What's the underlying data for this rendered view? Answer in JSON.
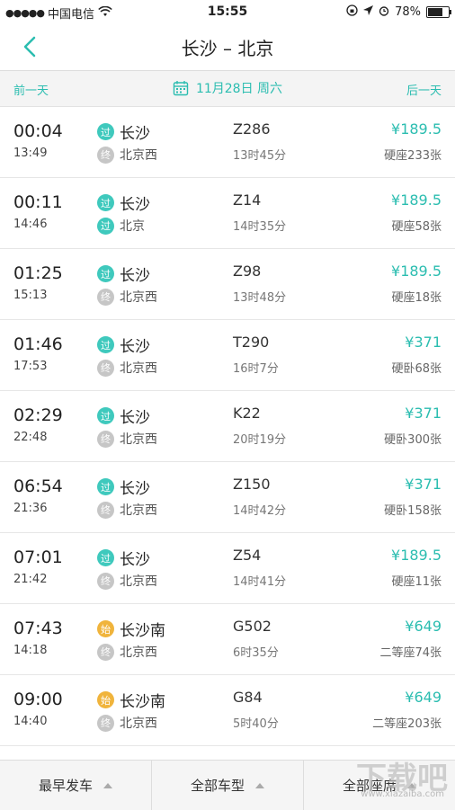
{
  "status": {
    "signal_dots": "●●●●●",
    "carrier": "中国电信",
    "time": "15:55",
    "battery": "78%",
    "battery_level": 0.78
  },
  "nav": {
    "title": "长沙 – 北京"
  },
  "datebar": {
    "prev": "前一天",
    "date": "11月28日 周六",
    "next": "后一天"
  },
  "colors": {
    "accent": "#2bbdb0",
    "pass_badge": "#3fc9bd",
    "end_badge": "#c6c6c6",
    "start_badge": "#f0b43c"
  },
  "trains": [
    {
      "dep": "00:04",
      "arr": "13:49",
      "from_badge": "过",
      "from_type": "pass",
      "from": "长沙",
      "to_badge": "终",
      "to_type": "end",
      "to": "北京西",
      "train": "Z286",
      "duration": "13时45分",
      "price": "¥189.5",
      "seat": "硬座233张"
    },
    {
      "dep": "00:11",
      "arr": "14:46",
      "from_badge": "过",
      "from_type": "pass",
      "from": "长沙",
      "to_badge": "过",
      "to_type": "pass",
      "to": "北京",
      "train": "Z14",
      "duration": "14时35分",
      "price": "¥189.5",
      "seat": "硬座58张"
    },
    {
      "dep": "01:25",
      "arr": "15:13",
      "from_badge": "过",
      "from_type": "pass",
      "from": "长沙",
      "to_badge": "终",
      "to_type": "end",
      "to": "北京西",
      "train": "Z98",
      "duration": "13时48分",
      "price": "¥189.5",
      "seat": "硬座18张"
    },
    {
      "dep": "01:46",
      "arr": "17:53",
      "from_badge": "过",
      "from_type": "pass",
      "from": "长沙",
      "to_badge": "终",
      "to_type": "end",
      "to": "北京西",
      "train": "T290",
      "duration": "16时7分",
      "price": "¥371",
      "seat": "硬卧68张"
    },
    {
      "dep": "02:29",
      "arr": "22:48",
      "from_badge": "过",
      "from_type": "pass",
      "from": "长沙",
      "to_badge": "终",
      "to_type": "end",
      "to": "北京西",
      "train": "K22",
      "duration": "20时19分",
      "price": "¥371",
      "seat": "硬卧300张"
    },
    {
      "dep": "06:54",
      "arr": "21:36",
      "from_badge": "过",
      "from_type": "pass",
      "from": "长沙",
      "to_badge": "终",
      "to_type": "end",
      "to": "北京西",
      "train": "Z150",
      "duration": "14时42分",
      "price": "¥371",
      "seat": "硬卧158张"
    },
    {
      "dep": "07:01",
      "arr": "21:42",
      "from_badge": "过",
      "from_type": "pass",
      "from": "长沙",
      "to_badge": "终",
      "to_type": "end",
      "to": "北京西",
      "train": "Z54",
      "duration": "14时41分",
      "price": "¥189.5",
      "seat": "硬座11张"
    },
    {
      "dep": "07:43",
      "arr": "14:18",
      "from_badge": "始",
      "from_type": "start",
      "from": "长沙南",
      "to_badge": "终",
      "to_type": "end",
      "to": "北京西",
      "train": "G502",
      "duration": "6时35分",
      "price": "¥649",
      "seat": "二等座74张"
    },
    {
      "dep": "09:00",
      "arr": "14:40",
      "from_badge": "始",
      "from_type": "start",
      "from": "长沙南",
      "to_badge": "终",
      "to_type": "end",
      "to": "北京西",
      "train": "G84",
      "duration": "5时40分",
      "price": "¥649",
      "seat": "二等座203张"
    }
  ],
  "bottom": {
    "tab1": "最早发车",
    "tab2": "全部车型",
    "tab3": "全部座席"
  },
  "watermark": {
    "logo": "下载吧",
    "url": "www.xiazaiba.com"
  }
}
